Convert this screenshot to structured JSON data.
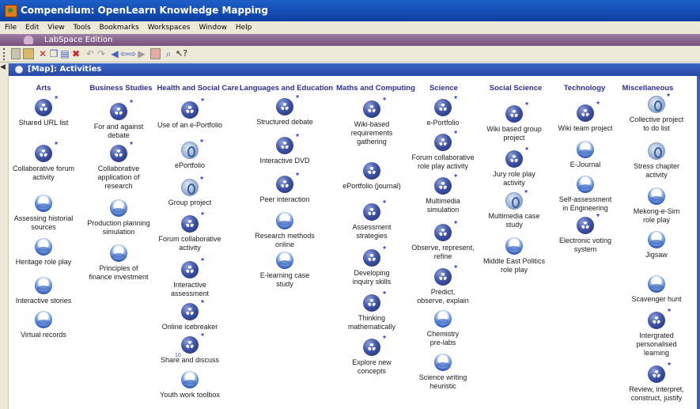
{
  "window": {
    "title": "Compendium: OpenLearn Knowledge Mapping"
  },
  "menu": [
    "File",
    "Edit",
    "View",
    "Tools",
    "Bookmarks",
    "Workspaces",
    "Window",
    "Help"
  ],
  "edition": "LabSpace Edition",
  "map_title": "[Map]: Activities",
  "columns": [
    {
      "header": "Arts",
      "nodes": [
        {
          "label": "Shared URL list",
          "icon": "map",
          "star": true
        },
        {
          "label": "Collaborative forum\nactivity",
          "icon": "map",
          "star": true
        },
        {
          "label": "Assessing historial\nsources",
          "icon": "ref"
        },
        {
          "label": "Heritage role play",
          "icon": "ref"
        },
        {
          "label": "Interactive stories",
          "icon": "ref"
        },
        {
          "label": "Virtual records",
          "icon": "ref"
        }
      ]
    },
    {
      "header": "Business Studies",
      "nodes": [
        {
          "label": "For and against\ndebate",
          "icon": "map",
          "star": true
        },
        {
          "label": "Collaborative\napplication of\nresearch",
          "icon": "map",
          "star": true
        },
        {
          "label": "Production planning\nsimulation",
          "icon": "ref"
        },
        {
          "label": "Principles of\nfinance investment",
          "icon": "ref"
        }
      ]
    },
    {
      "header": "Health and Social Care",
      "nodes": [
        {
          "label": "Use of an e-Portfolio",
          "icon": "map",
          "star": true
        },
        {
          "label": "ePortfolio",
          "icon": "url",
          "star": true
        },
        {
          "label": "Group project",
          "icon": "url",
          "star": true
        },
        {
          "label": "Forum collaborative\nactivity",
          "icon": "map",
          "star": true
        },
        {
          "label": "Interactive\nassessment",
          "icon": "map",
          "star": true
        },
        {
          "label": "Online icebreaker",
          "icon": "map",
          "star": true
        },
        {
          "label": "Share and discuss",
          "icon": "map",
          "star": true,
          "count": "10"
        },
        {
          "label": "Youth work toolbox",
          "icon": "ref"
        }
      ]
    },
    {
      "header": "Languages and Education",
      "nodes": [
        {
          "label": "Structured debate",
          "icon": "map",
          "star": true
        },
        {
          "label": "Interactive DVD",
          "icon": "map",
          "star": true
        },
        {
          "label": "Peer interaction",
          "icon": "map",
          "star": true
        },
        {
          "label": "Research methods\nonline",
          "icon": "ref"
        },
        {
          "label": "E-learning case\nstudy",
          "icon": "ref"
        }
      ]
    },
    {
      "header": "Maths and Computing",
      "nodes": [
        {
          "label": "Wiki-based\nrequirements\ngathering",
          "icon": "map",
          "star": true
        },
        {
          "label": "ePortfolio (journal)",
          "icon": "map"
        },
        {
          "label": "Assessment\nstrategies",
          "icon": "map",
          "star": true
        },
        {
          "label": "Developing\ninquiry skills",
          "icon": "map",
          "star": true
        },
        {
          "label": "Thinking\nmathematically",
          "icon": "map",
          "star": true
        },
        {
          "label": "Explore new\nconcepts",
          "icon": "map",
          "star": true
        }
      ]
    },
    {
      "header": "Science",
      "nodes": [
        {
          "label": "e-Portfolio",
          "icon": "map",
          "star": true
        },
        {
          "label": "Forum collaborative\nrole play activity",
          "icon": "map",
          "star": true
        },
        {
          "label": "Multimedia\nsimulation",
          "icon": "map",
          "star": true
        },
        {
          "label": "Observe, represent,\nrefine",
          "icon": "map",
          "star": true
        },
        {
          "label": "Predict,\nobserve, explain",
          "icon": "map",
          "star": true
        },
        {
          "label": "Chemistry\npre-labs",
          "icon": "ref"
        },
        {
          "label": "Science writing\nheuristic",
          "icon": "ref"
        }
      ]
    },
    {
      "header": "Social Science",
      "nodes": [
        {
          "label": "Wiki based group\nproject",
          "icon": "map",
          "star": true
        },
        {
          "label": "Jury role play\nactivity",
          "icon": "map",
          "star": true
        },
        {
          "label": "Multimedia case\nstudy",
          "icon": "url",
          "star": true
        },
        {
          "label": "Middle East Politics\nrole play",
          "icon": "ref"
        }
      ]
    },
    {
      "header": "Technology",
      "nodes": [
        {
          "label": "Wiki team project",
          "icon": "map",
          "star": true
        },
        {
          "label": "E-Journal",
          "icon": "ref"
        },
        {
          "label": "Self-assessment\nin Engineering",
          "icon": "ref"
        },
        {
          "label": "Electronic voting\nsystem",
          "icon": "map",
          "star": true
        }
      ]
    },
    {
      "header": "Miscellaneous",
      "nodes": [
        {
          "label": "Collective project\nto do list",
          "icon": "url",
          "star": true
        },
        {
          "label": "Stress chapter\nactivity",
          "icon": "url"
        },
        {
          "label": "Mekong-e-Sim\nrole play",
          "icon": "ref"
        },
        {
          "label": "Jigsaw",
          "icon": "ref"
        },
        {
          "label": "Scavenger hunt",
          "icon": "ref"
        },
        {
          "label": "Intergrated\npersonalised\nlearning",
          "icon": "map",
          "star": true
        },
        {
          "label": "Review, interpret,\nconstruct, justify",
          "icon": "map",
          "star": true
        }
      ]
    }
  ]
}
